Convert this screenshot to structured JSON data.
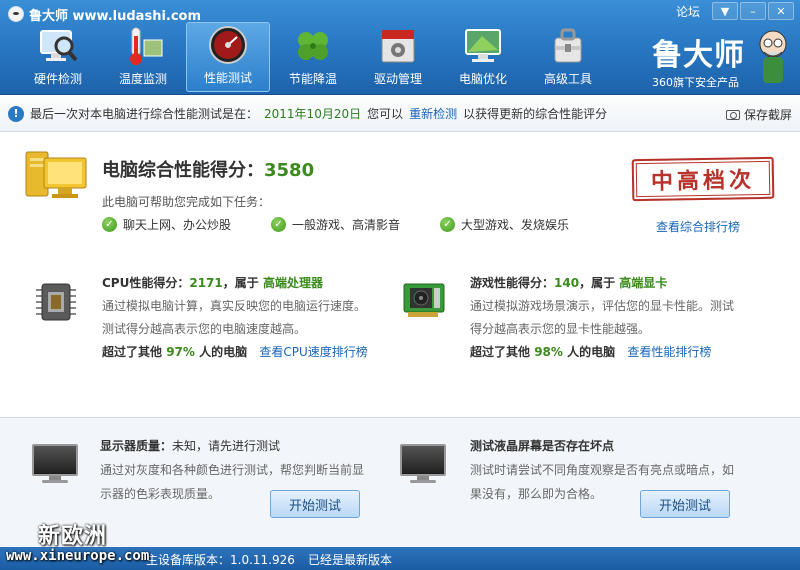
{
  "window": {
    "title": "鲁大师 www.ludashi.com",
    "forum": "论坛",
    "controls": [
      "▼",
      "–",
      "✕"
    ]
  },
  "nav": [
    {
      "label": "硬件检测",
      "icon": "pc-magnifier-icon",
      "active": false
    },
    {
      "label": "温度监测",
      "icon": "thermometer-icon",
      "active": false
    },
    {
      "label": "性能测试",
      "icon": "speedometer-icon",
      "active": true
    },
    {
      "label": "节能降温",
      "icon": "clover-icon",
      "active": false
    },
    {
      "label": "驱动管理",
      "icon": "driver-box-icon",
      "active": false
    },
    {
      "label": "电脑优化",
      "icon": "monitor-optimize-icon",
      "active": false
    },
    {
      "label": "高级工具",
      "icon": "toolbox-icon",
      "active": false
    }
  ],
  "brand": {
    "name": "鲁大师",
    "subtitle": "360旗下安全产品"
  },
  "notice": {
    "prefix": "最后一次对本电脑进行综合性能测试是在：",
    "date": "2011年10月20日",
    "middle": "您可以",
    "retest_link": "重新检测",
    "suffix": "以获得更新的综合性能评分",
    "save_screenshot": "保存截屏"
  },
  "score": {
    "title": "电脑综合性能得分：",
    "value": "3580",
    "subtitle": "此电脑可帮助您完成如下任务：",
    "tasks": [
      "聊天上网、办公炒股",
      "一般游戏、高清影音",
      "大型游戏、发烧娱乐"
    ],
    "rank_link": "查看综合排行榜",
    "stamp": "中高档次"
  },
  "cpu": {
    "label": "CPU性能得分：",
    "value": "2171",
    "belongs": "，属于",
    "level": "高端处理器",
    "desc1": "通过模拟电脑计算，真实反映您的电脑运行速度。",
    "desc2": "测试得分越高表示您的电脑速度越高。",
    "beat_prefix": "超过了其他",
    "beat_pct": "97%",
    "beat_suffix": "人的电脑",
    "link": "查看CPU速度排行榜"
  },
  "gpu": {
    "label": "游戏性能得分：",
    "value": "140",
    "belongs": "，属于",
    "level": "高端显卡",
    "desc1": "通过模拟游戏场景演示，评估您的显卡性能。测试",
    "desc2": "得分越高表示您的显卡性能越强。",
    "beat_prefix": "超过了其他",
    "beat_pct": "98%",
    "beat_suffix": "人的电脑",
    "link": "查看性能排行榜"
  },
  "display_test": {
    "label": "显示器质量：",
    "status": "未知，请先进行测试",
    "desc1": "通过对灰度和各种颜色进行测试，帮您判断当前显",
    "desc2": "示器的色彩表现质量。",
    "button": "开始测试"
  },
  "lcd_test": {
    "label": "测试液晶屏幕是否存在坏点",
    "desc1": "测试时请尝试不同角度观察是否有亮点或暗点，如",
    "desc2": "果没有，那么即为合格。",
    "button": "开始测试"
  },
  "status": {
    "db_version": "主设备库版本：1.0.11.926",
    "latest": "已经是最新版本"
  },
  "watermark": {
    "cn": "新欧洲",
    "en": "www.xineurope.com"
  }
}
